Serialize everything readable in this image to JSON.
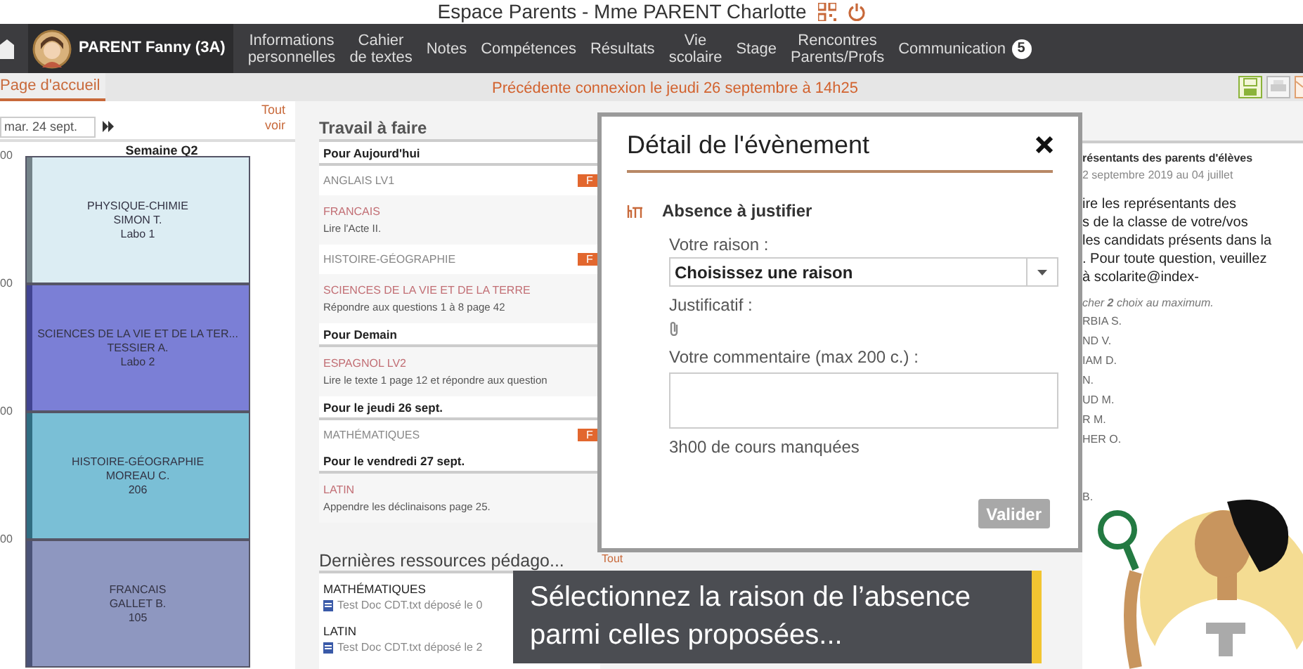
{
  "window": {
    "title": "Espace Parents - Mme PARENT Charlotte"
  },
  "nav": {
    "student": "PARENT Fanny (3A)",
    "items": [
      {
        "label": "Informations\npersonnelles",
        "selected": false
      },
      {
        "label": "Cahier\nde textes",
        "selected": false
      },
      {
        "label": "Notes",
        "selected": false
      },
      {
        "label": "Compétences",
        "selected": false
      },
      {
        "label": "Résultats",
        "selected": false
      },
      {
        "label": "Vie\nscolaire",
        "selected": false
      },
      {
        "label": "Stage",
        "selected": false
      },
      {
        "label": "Rencontres\nParents/Profs",
        "selected": false
      },
      {
        "label": "Communication",
        "selected": false,
        "badge": "5"
      }
    ]
  },
  "subbar": {
    "tabs": [
      {
        "label": "Page d'accueil",
        "selected": true
      }
    ],
    "notice": "Précédente connexion le jeudi 26 septembre à 14h25"
  },
  "schedule": {
    "date": "mar. 24 sept.",
    "see_all": "Tout\nvoir",
    "week": "Semaine Q2",
    "hours": [
      "00",
      "00",
      "00",
      "00"
    ],
    "lessons": [
      {
        "subject": "PHYSIQUE-CHIMIE",
        "teacher": "SIMON T.",
        "room": "Labo 1",
        "color": "#dcedf3"
      },
      {
        "subject": "SCIENCES DE LA VIE ET DE LA TER...",
        "teacher": "TESSIER A.",
        "room": "Labo 2",
        "color": "#7b7fd6"
      },
      {
        "subject": "HISTOIRE-GÉOGRAPHIE",
        "teacher": "MOREAU C.",
        "room": "206",
        "color": "#7abfd6"
      },
      {
        "subject": "FRANCAIS",
        "teacher": "GALLET B.",
        "room": "105",
        "color": "#8e97c0"
      }
    ]
  },
  "homework": {
    "title": "Travail à faire",
    "groups": [
      {
        "heading": "Pour Aujourd'hui",
        "items": [
          {
            "subject": "ANGLAIS LV1",
            "badge": "F"
          },
          {
            "subject": "FRANCAIS",
            "text": "Lire l'Acte II."
          },
          {
            "subject": "HISTOIRE-GÉOGRAPHIE",
            "badge": "F"
          },
          {
            "subject": "SCIENCES DE LA VIE ET DE LA TERRE",
            "text": "Répondre aux questions 1 à 8 page 42"
          }
        ]
      },
      {
        "heading": "Pour Demain",
        "items": [
          {
            "subject": "ESPAGNOL LV2",
            "text": "Lire le texte 1 page 12 et répondre aux question"
          }
        ]
      },
      {
        "heading": "Pour le jeudi 26 sept.",
        "items": [
          {
            "subject": "MATHÉMATIQUES",
            "badge": "F"
          }
        ]
      },
      {
        "heading": "Pour le vendredi 27 sept.",
        "items": [
          {
            "subject": "LATIN",
            "text": "Appendre les déclinaisons page 25."
          }
        ]
      }
    ]
  },
  "resources": {
    "title": "Dernières ressources pédago...",
    "see_all": "Tout",
    "items": [
      {
        "subject": "MATHÉMATIQUES",
        "file": "Test Doc CDT.txt déposé le 0"
      },
      {
        "subject": "LATIN",
        "file": "Test Doc CDT.txt déposé le 2"
      }
    ]
  },
  "dialog": {
    "title": "Détail de l'évènement",
    "event": "Absence à justifier",
    "reason_label": "Votre raison :",
    "reason_value": "Choisissez une raison",
    "proof_label": "Justificatif :",
    "comment_label": "Votre commentaire (max 200 c.) :",
    "missed": "3h00 de cours manquées",
    "submit": {
      "label": "Valider",
      "disabled": true
    }
  },
  "right_panel": {
    "title": "résentants des parents d'élèves",
    "dates": "2 septembre 2019 au 04 juillet",
    "lines": [
      "ire les représentants des",
      "s de la classe de votre/vos",
      "les candidats présents dans la",
      ". Pour toute question, veuillez",
      "à scolarite@index-"
    ],
    "note": "cher **2** choix au maximum.",
    "candidates": [
      "RBIA S.",
      "ND V.",
      "IAM D.",
      "N.",
      "UD M.",
      "R M.",
      "HER O."
    ],
    "last": "B."
  },
  "subtitle": [
    "Sélectionnez la raison de l’absence",
    "parmi celles proposées..."
  ]
}
